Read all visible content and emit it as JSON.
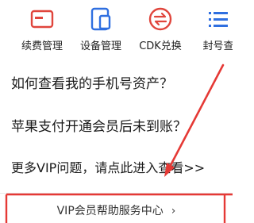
{
  "shortcuts": [
    {
      "label": "续费管理",
      "icon": "card-icon",
      "color": "#e0453c"
    },
    {
      "label": "设备管理",
      "icon": "device-icon",
      "color": "#2f6fe0"
    },
    {
      "label": "CDK兑换",
      "icon": "exchange-icon",
      "color": "#e0453c"
    },
    {
      "label": "封号查",
      "icon": "list-icon",
      "color": "#2f6fe0"
    }
  ],
  "faq": [
    {
      "text": "如何查看我的手机号资产？"
    },
    {
      "text": "苹果支付开通会员后未到账？"
    },
    {
      "text": "更多VIP问题，请点此进入查看>>"
    }
  ],
  "help_center": {
    "label": "VIP会员帮助服务中心",
    "chevron": "›"
  },
  "colors": {
    "annotation": "#e53935",
    "red_icon": "#e0453c",
    "blue_icon": "#2f6fe0"
  }
}
